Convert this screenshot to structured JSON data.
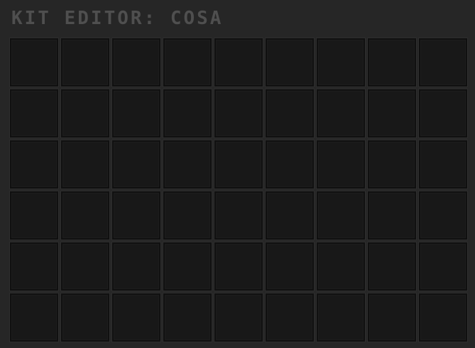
{
  "window": {
    "title": "KIT EDITOR: COSA"
  },
  "grid": {
    "rows": 6,
    "columns": 9
  },
  "colors": {
    "background": "#262626",
    "pad": "#181818",
    "pad_border": "#101010",
    "title_text": "#4f4f4f"
  }
}
